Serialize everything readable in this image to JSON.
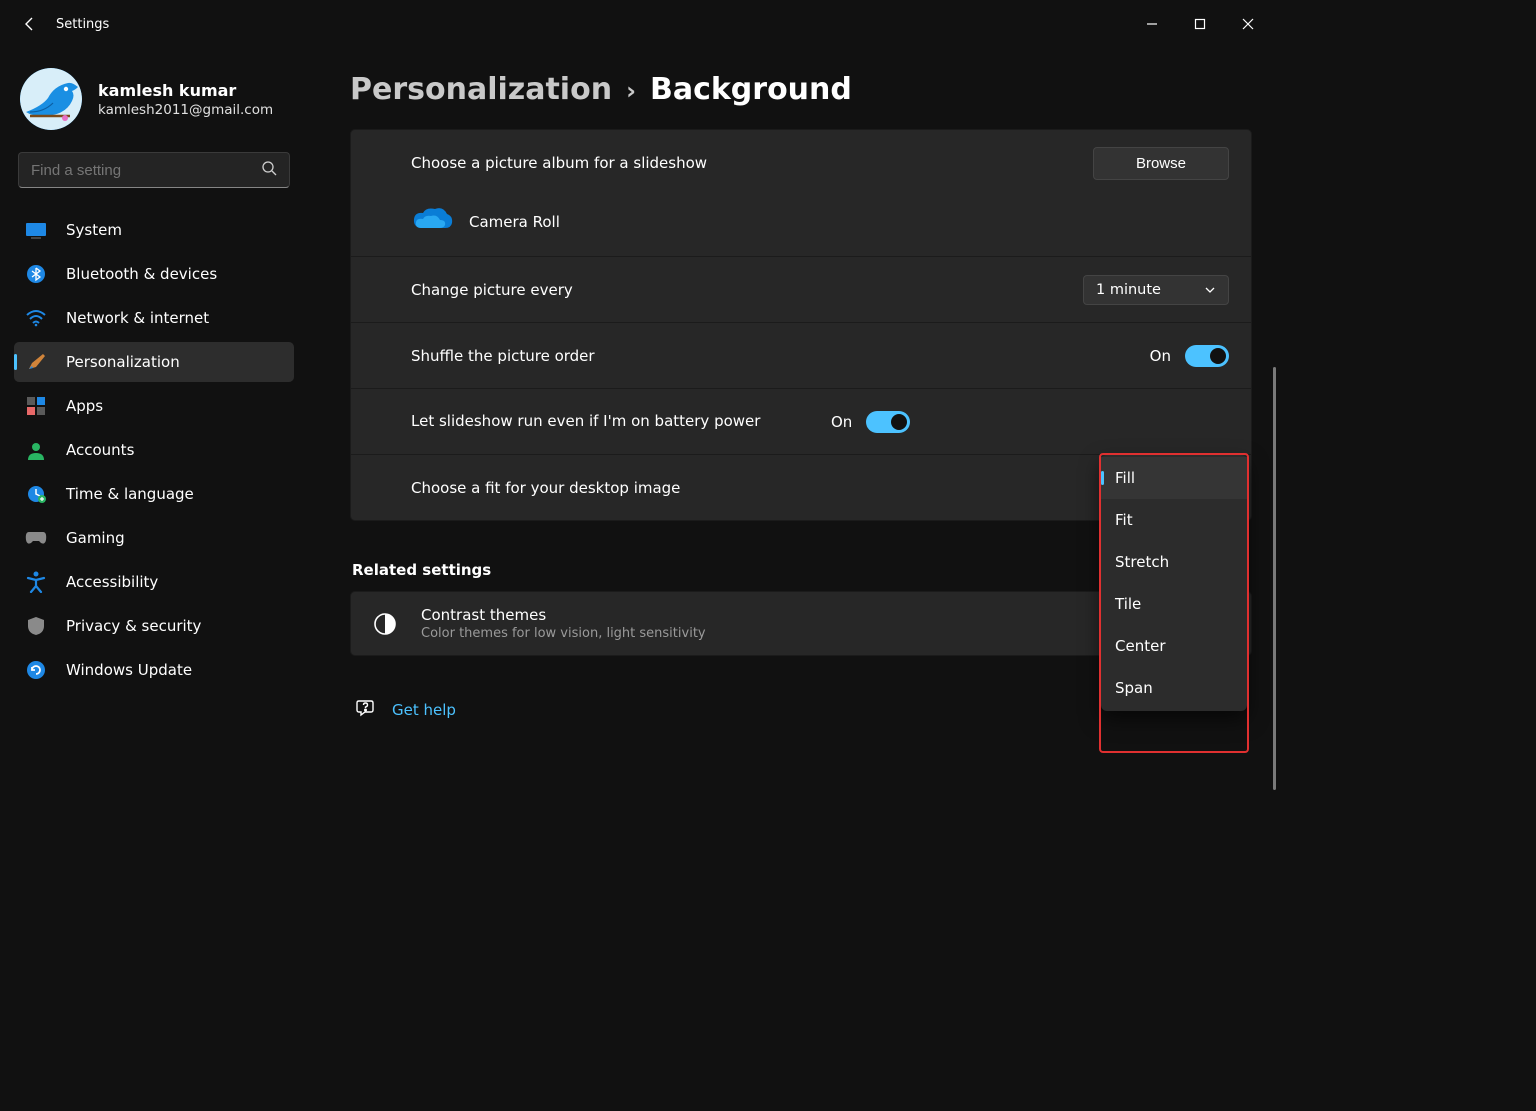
{
  "app": {
    "title": "Settings"
  },
  "profile": {
    "name": "kamlesh kumar",
    "email": "kamlesh2011@gmail.com"
  },
  "search": {
    "placeholder": "Find a setting"
  },
  "nav": {
    "items": [
      {
        "label": "System"
      },
      {
        "label": "Bluetooth & devices"
      },
      {
        "label": "Network & internet"
      },
      {
        "label": "Personalization"
      },
      {
        "label": "Apps"
      },
      {
        "label": "Accounts"
      },
      {
        "label": "Time & language"
      },
      {
        "label": "Gaming"
      },
      {
        "label": "Accessibility"
      },
      {
        "label": "Privacy & security"
      },
      {
        "label": "Windows Update"
      }
    ]
  },
  "breadcrumb": {
    "parent": "Personalization",
    "current": "Background"
  },
  "settings": {
    "choose_album_label": "Choose a picture album for a slideshow",
    "browse_label": "Browse",
    "album_name": "Camera Roll",
    "change_every_label": "Change picture every",
    "change_every_value": "1 minute",
    "shuffle_label": "Shuffle the picture order",
    "shuffle_state": "On",
    "battery_label": "Let slideshow run even if I'm on battery power",
    "battery_state": "On",
    "fit_label": "Choose a fit for your desktop image",
    "fit_options": [
      "Fill",
      "Fit",
      "Stretch",
      "Tile",
      "Center",
      "Span"
    ],
    "fit_selected": "Fill"
  },
  "related": {
    "heading": "Related settings",
    "contrast_title": "Contrast themes",
    "contrast_desc": "Color themes for low vision, light sensitivity"
  },
  "help": {
    "label": "Get help"
  }
}
